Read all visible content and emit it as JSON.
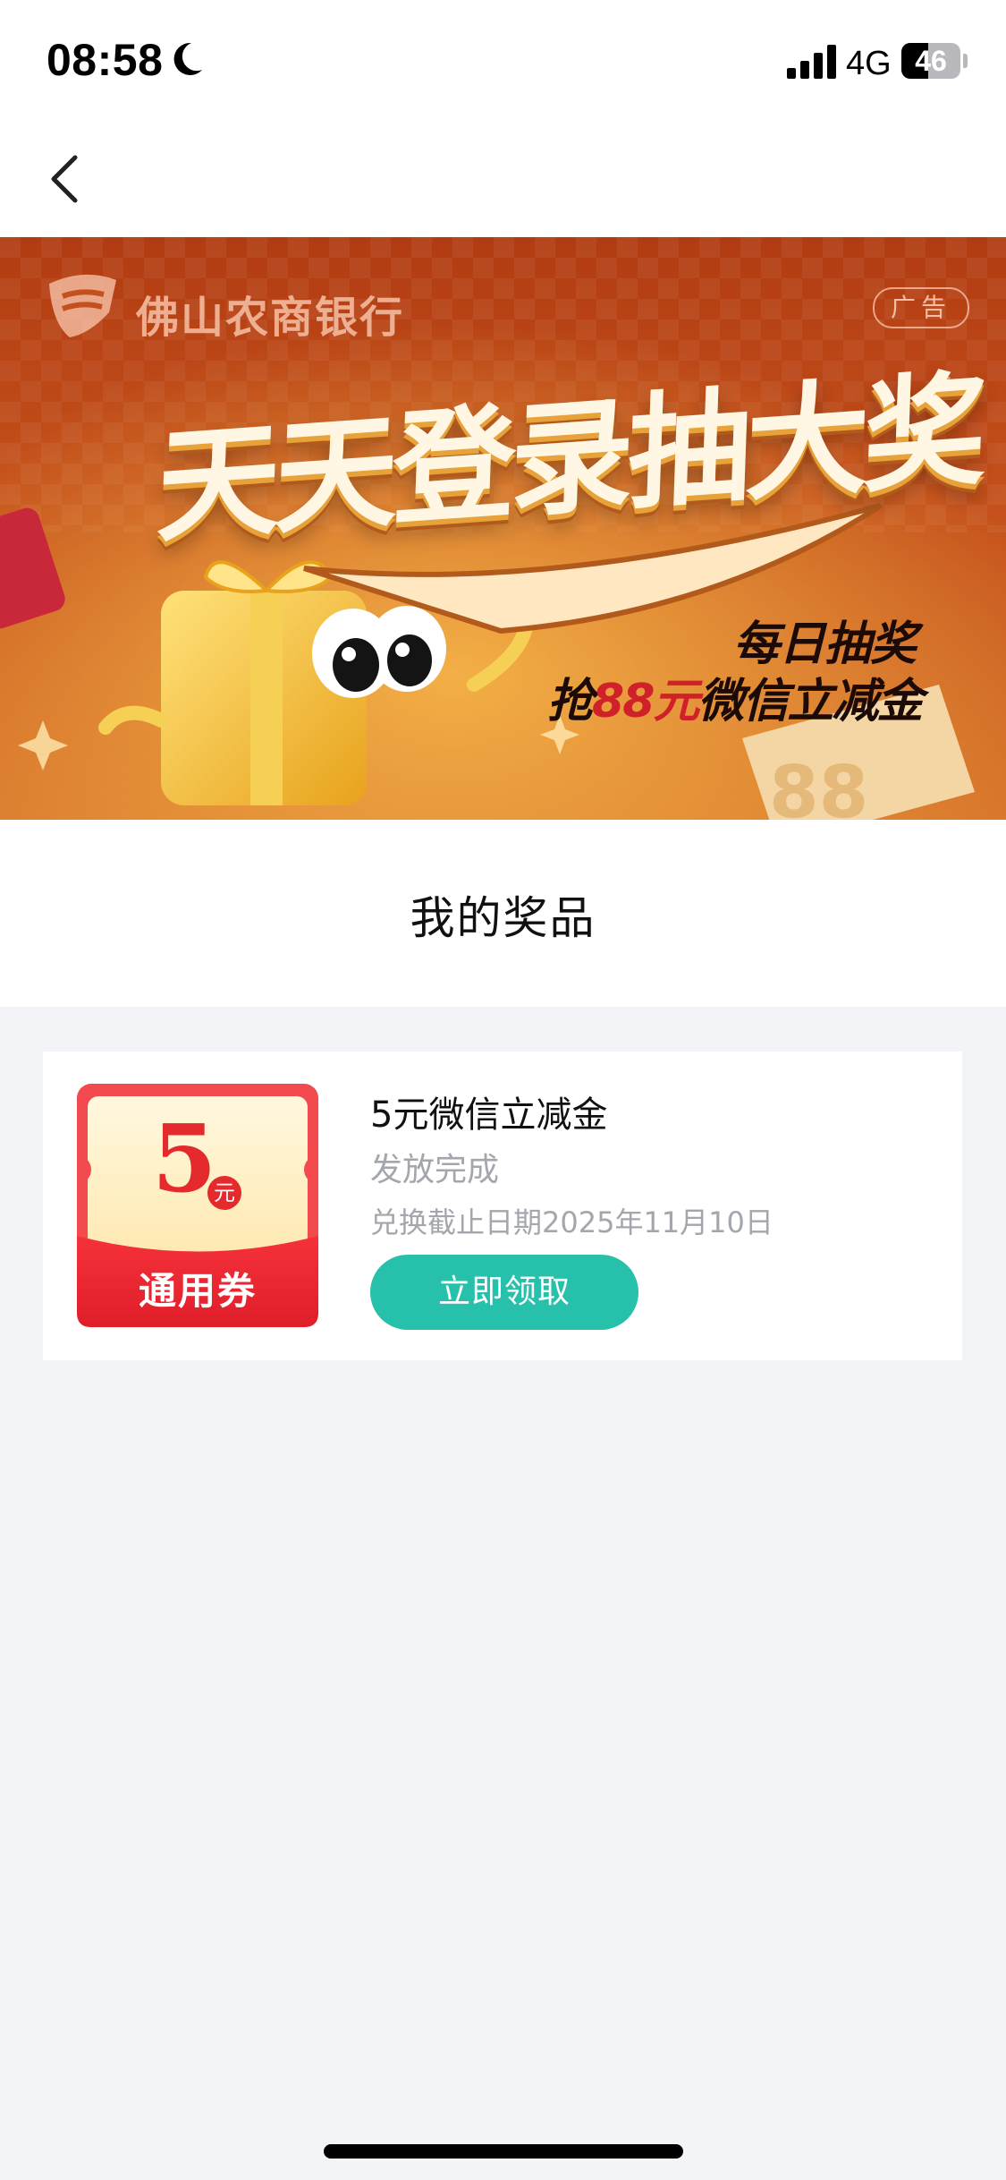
{
  "status_bar": {
    "time": "08:58",
    "network": "4G",
    "battery_percent": 46,
    "battery_label": "46"
  },
  "nav": {
    "back_icon": "chevron-left-icon"
  },
  "banner": {
    "bank_name": "佛山农商银行",
    "ad_label": "广告",
    "headline": "天天登录抽大奖",
    "subline_1": "每日抽奖",
    "subline_2_prefix": "抢",
    "subline_2_amount": "88元",
    "subline_2_suffix": "微信立减金"
  },
  "page": {
    "section_title": "我的奖品"
  },
  "prizes": [
    {
      "coupon_value": "5",
      "coupon_unit": "元",
      "coupon_label": "通用券",
      "title": "5元微信立减金",
      "status": "发放完成",
      "deadline": "兑换截止日期2025年11月10日",
      "action_label": "立即领取"
    }
  ],
  "colors": {
    "accent": "#27c1ab",
    "coupon_red": "#e42a2c",
    "page_bg": "#f3f4f8",
    "muted_text": "#a4a6ad"
  }
}
